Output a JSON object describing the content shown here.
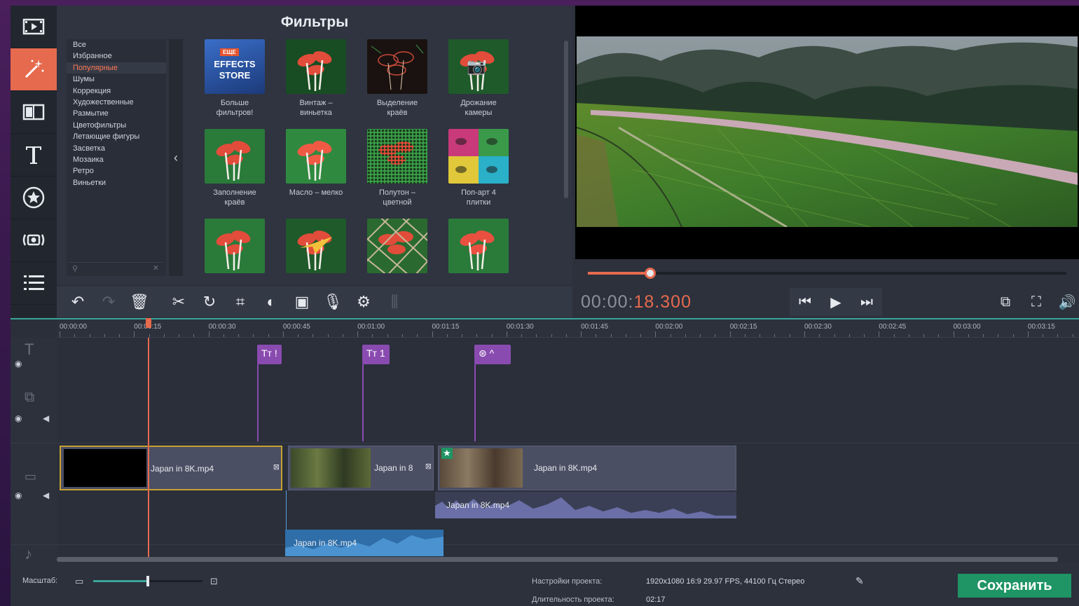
{
  "sidebar_tools": [
    {
      "name": "import-media-tool",
      "icon": "film-icon"
    },
    {
      "name": "filters-tool",
      "icon": "magic-wand-icon",
      "active": true
    },
    {
      "name": "transitions-tool",
      "icon": "transition-icon"
    },
    {
      "name": "titles-tool",
      "icon": "text-icon"
    },
    {
      "name": "stickers-tool",
      "icon": "star-badge-icon"
    },
    {
      "name": "stabilization-tool",
      "icon": "camera-shake-icon"
    },
    {
      "name": "more-tools",
      "icon": "list-icon"
    }
  ],
  "filters": {
    "title": "Фильтры",
    "categories": [
      "Все",
      "Избранное",
      "Популярные",
      "Шумы",
      "Коррекция",
      "Художественные",
      "Размытие",
      "Цветофильтры",
      "Летающие фигуры",
      "Засветка",
      "Мозаика",
      "Ретро",
      "Виньетки"
    ],
    "active_category": "Популярные",
    "tiles": [
      {
        "label": "Больше фильтров!",
        "style": "store",
        "badge": "ЕЩЕ",
        "store_text": "EFFECTS STORE"
      },
      {
        "label": "Винтаж – виньетка",
        "style": "vignette"
      },
      {
        "label": "Выделение краёв",
        "style": "edges"
      },
      {
        "label": "Дрожание камеры",
        "style": "shake"
      },
      {
        "label": "Заполнение краёв",
        "style": "fill"
      },
      {
        "label": "Масло – мелко",
        "style": "oil"
      },
      {
        "label": "Полутон – цветной",
        "style": "halftone"
      },
      {
        "label": "Поп-арт 4 плитки",
        "style": "popart"
      },
      {
        "label": "",
        "style": "plain"
      },
      {
        "label": "",
        "style": "plane"
      },
      {
        "label": "",
        "style": "grid"
      },
      {
        "label": "",
        "style": "plain2"
      }
    ]
  },
  "player": {
    "progress": 0.13,
    "timecode_dim": "00:00:",
    "timecode_bright": "18.300"
  },
  "toolbar": {
    "buttons": [
      "undo-icon",
      "redo-icon",
      "trash-icon",
      "scissors-icon",
      "rotate-icon",
      "crop-icon",
      "color-adjust-icon",
      "image-icon",
      "microphone-icon",
      "gear-icon",
      "equalizer-icon"
    ]
  },
  "timeline": {
    "ticks": [
      "00:00:00",
      "00:00:15",
      "00:00:30",
      "00:00:45",
      "00:01:00",
      "00:01:15",
      "00:01:30",
      "00:01:45",
      "00:02:00",
      "00:02:15",
      "00:02:30",
      "00:02:45",
      "00:03:00",
      "00:03:15"
    ],
    "markers": [
      {
        "text": "Tт !",
        "type": "title"
      },
      {
        "text": "Tт 1",
        "type": "title"
      },
      {
        "text": "⊛ ^",
        "type": "sticker"
      }
    ],
    "clips": [
      {
        "label": "Japan in 8K.mp4"
      },
      {
        "label": "Japan in 8"
      },
      {
        "label": "Japan in 8K.mp4"
      }
    ],
    "audio_clips": [
      {
        "label": "Japan in 8K.mp4"
      },
      {
        "label": "Japan in 8K.mp4"
      }
    ]
  },
  "bottom": {
    "scale_label": "Масштаб:",
    "zoom_level": 0.5,
    "settings_label": "Настройки проекта:",
    "settings_value": "1920x1080 16:9 29.97 FPS, 44100 Гц Стерео",
    "duration_label": "Длительность проекта:",
    "duration_value": "02:17",
    "save_label": "Сохранить"
  },
  "colors": {
    "accent": "#e66a4e",
    "save": "#1f9464",
    "marker": "#8a4bb0",
    "timeline_line": "#3aa49a"
  }
}
